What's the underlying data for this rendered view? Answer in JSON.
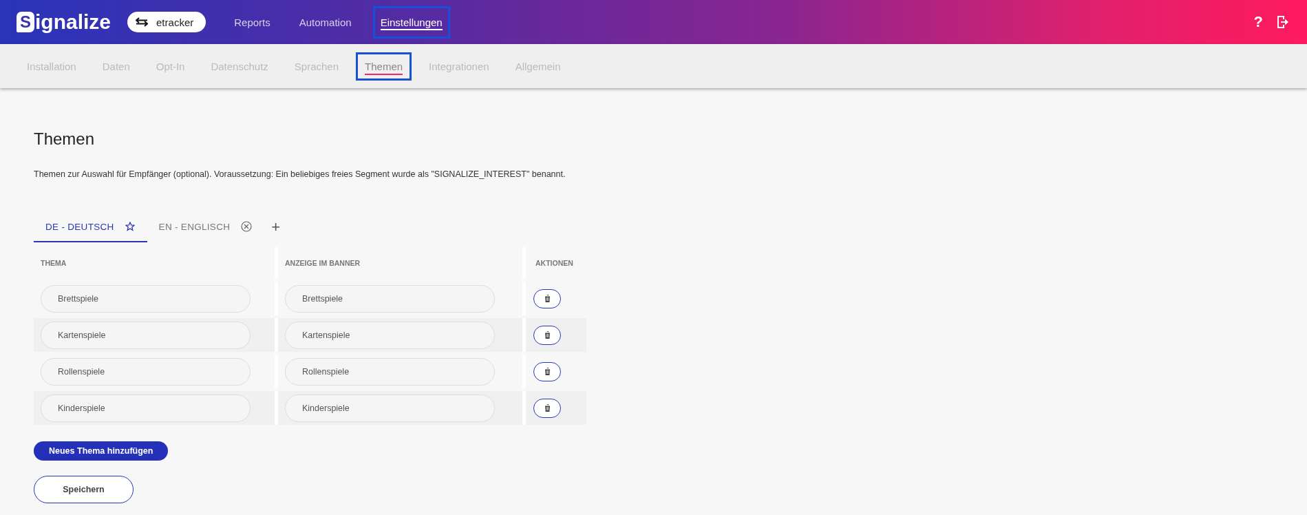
{
  "header": {
    "logo": {
      "mark": "S",
      "text": "ignalize"
    },
    "account": {
      "label": "etracker"
    },
    "nav": [
      {
        "label": "Reports",
        "selected": false,
        "highlighted": false
      },
      {
        "label": "Automation",
        "selected": false,
        "highlighted": false
      },
      {
        "label": "Einstellungen",
        "selected": true,
        "highlighted": true
      }
    ],
    "help": "?"
  },
  "subnav": [
    {
      "label": "Installation",
      "selected": false,
      "highlighted": false
    },
    {
      "label": "Daten",
      "selected": false,
      "highlighted": false
    },
    {
      "label": "Opt-In",
      "selected": false,
      "highlighted": false
    },
    {
      "label": "Datenschutz",
      "selected": false,
      "highlighted": false
    },
    {
      "label": "Sprachen",
      "selected": false,
      "highlighted": false
    },
    {
      "label": "Themen",
      "selected": true,
      "highlighted": true
    },
    {
      "label": "Integrationen",
      "selected": false,
      "highlighted": false
    },
    {
      "label": "Allgemein",
      "selected": false,
      "highlighted": false
    }
  ],
  "title": "Themen",
  "description": "Themen zur Auswahl für Empfänger (optional). Voraussetzung: Ein beliebiges freies Segment wurde als \"SIGNALIZE_INTEREST\" benannt.",
  "language_tabs": [
    {
      "label": "DE - DEUTSCH",
      "selected": true,
      "kind": "default"
    },
    {
      "label": "EN - ENGLISCH",
      "selected": false,
      "kind": "removable"
    }
  ],
  "add_tab": "+",
  "table": {
    "columns": [
      "THEMA",
      "ANZEIGE IM BANNER",
      "AKTIONEN"
    ],
    "rows": [
      {
        "topic": "Brettspiele",
        "banner": "Brettspiele"
      },
      {
        "topic": "Kartenspiele",
        "banner": "Kartenspiele"
      },
      {
        "topic": "Rollenspiele",
        "banner": "Rollenspiele"
      },
      {
        "topic": "Kinderspiele",
        "banner": "Kinderspiele"
      }
    ]
  },
  "add_button": "Neues Thema hinzufügen",
  "save_button": "Speichern"
}
